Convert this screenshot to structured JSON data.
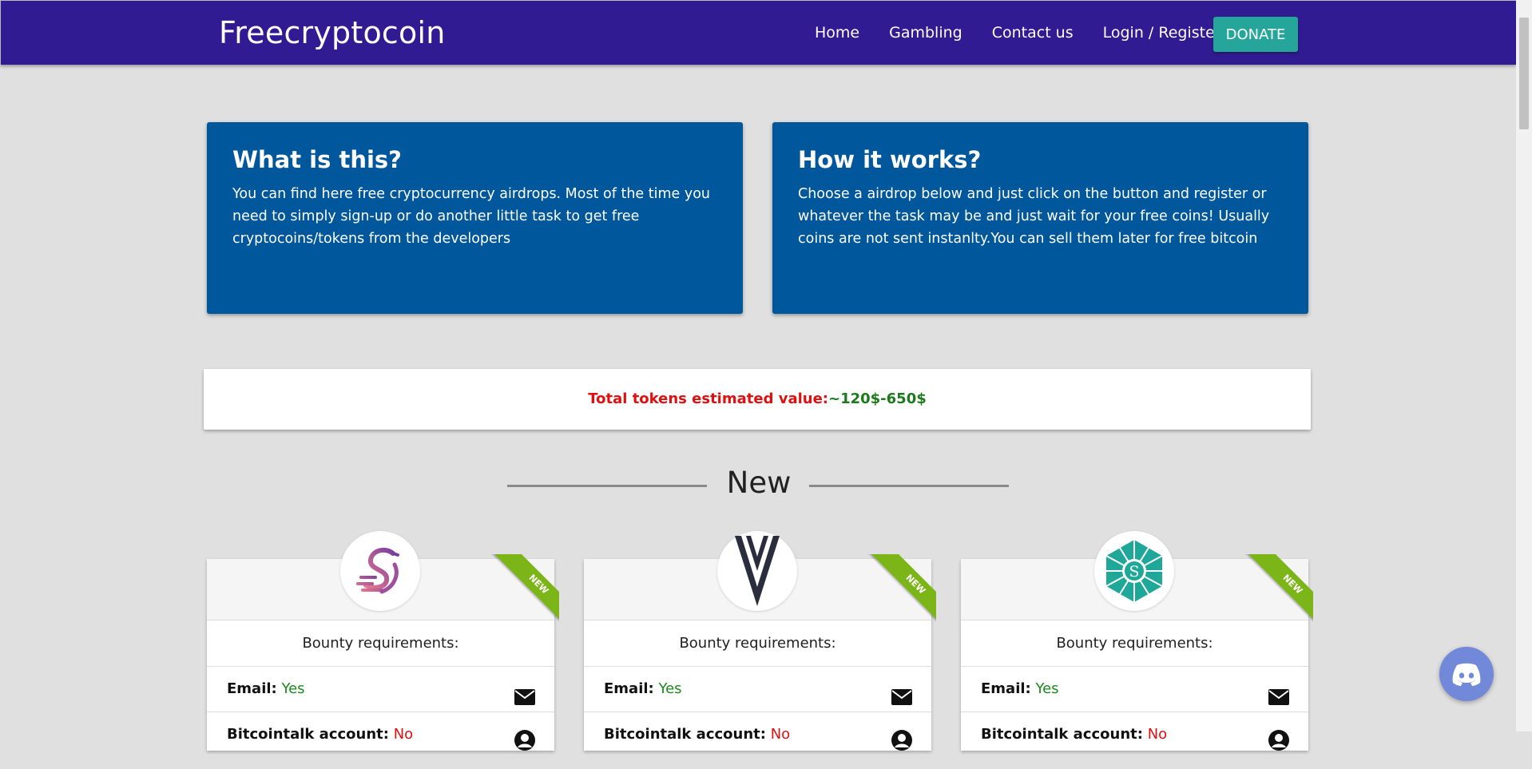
{
  "nav": {
    "brand": "Freecryptocoin",
    "links": [
      "Home",
      "Gambling",
      "Contact us",
      "Login / Register"
    ],
    "donate": "DONATE"
  },
  "info_cards": [
    {
      "title": "What is this?",
      "text": "You can find here free cryptocurrency airdrops. Most of the time you need to simply sign-up or do another little task to get free cryptocoins/tokens from the developers"
    },
    {
      "title": "How it works?",
      "text": "Choose a airdrop below and just click on the button and register or whatever the task may be and just wait for your free coins! Usually coins are not sent instanlty.You can sell them later for free bitcoin"
    }
  ],
  "estimate": {
    "label": "Total tokens estimated value:",
    "value": "~120$-650$"
  },
  "section": {
    "title": "New"
  },
  "airdrops": [
    {
      "ribbon": "NEW",
      "logo_icon": "swan-icon",
      "req_title": "Bounty requirements:",
      "email_label": "Email:",
      "email_value": "Yes",
      "bitcointalk_label": "Bitcointalk account:",
      "bitcointalk_value": "No"
    },
    {
      "ribbon": "NEW",
      "logo_icon": "double-v-icon",
      "req_title": "Bounty requirements:",
      "email_label": "Email:",
      "email_value": "Yes",
      "bitcointalk_label": "Bitcointalk account:",
      "bitcointalk_value": "No"
    },
    {
      "ribbon": "NEW",
      "logo_icon": "gem-s-icon",
      "req_title": "Bounty requirements:",
      "email_label": "Email:",
      "email_value": "Yes",
      "bitcointalk_label": "Bitcointalk account:",
      "bitcointalk_value": "No"
    }
  ],
  "colors": {
    "navbar": "#311b92",
    "info_card": "#01579b",
    "donate": "#26a69a",
    "ribbon": "#7cb518",
    "discord": "#7289da"
  }
}
